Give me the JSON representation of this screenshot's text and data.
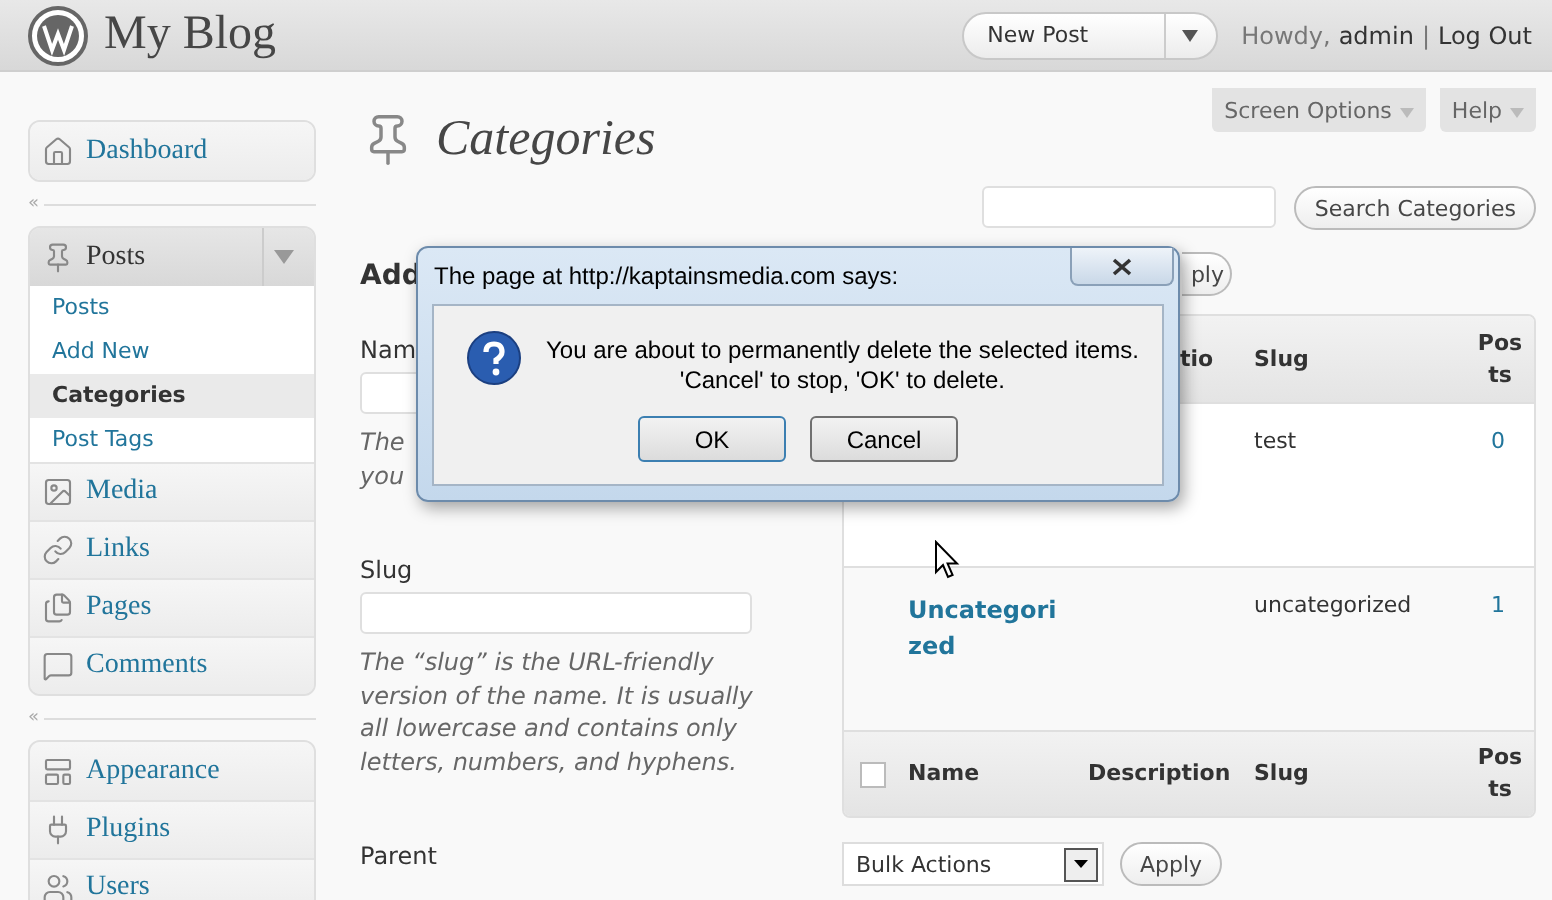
{
  "header": {
    "site_title": "My Blog",
    "new_post": "New Post",
    "greeting": "Howdy,",
    "user": "admin",
    "separator": "|",
    "logout": "Log Out"
  },
  "screen_tabs": [
    "Screen Options",
    "Help"
  ],
  "sidebar": {
    "groups": [
      {
        "items": [
          {
            "label": "Dashboard"
          }
        ]
      },
      {
        "items": [
          {
            "label": "Posts",
            "expanded": true,
            "children": [
              {
                "label": "Posts",
                "selected": false
              },
              {
                "label": "Add New",
                "selected": false
              },
              {
                "label": "Categories",
                "selected": true
              },
              {
                "label": "Post Tags",
                "selected": false
              }
            ]
          },
          {
            "label": "Media"
          },
          {
            "label": "Links"
          },
          {
            "label": "Pages"
          },
          {
            "label": "Comments"
          }
        ]
      },
      {
        "items": [
          {
            "label": "Appearance"
          },
          {
            "label": "Plugins"
          },
          {
            "label": "Users"
          }
        ]
      }
    ],
    "collapse_marks": [
      "«",
      "«"
    ]
  },
  "page_title": "Categories",
  "search": {
    "button": "Search Categories"
  },
  "form": {
    "heading": "Add",
    "fields": [
      {
        "label": "Nam",
        "description": "The you"
      },
      {
        "label": "Slug",
        "description": "The “slug” is the URL-friendly version of the name. It is usually all lowercase and contains only letters, numbers, and hyphens."
      },
      {
        "label": "Parent"
      }
    ]
  },
  "top_bulk": {
    "apply": "ply"
  },
  "table": {
    "header_top": {
      "description": "tio",
      "slug": "Slug",
      "posts": "Posts"
    },
    "rows": [
      {
        "slug": "test",
        "posts": "0"
      },
      {
        "name": "Uncategorized",
        "slug": "uncategorized",
        "posts": "1"
      }
    ],
    "footer": {
      "checked": false,
      "name": "Name",
      "description": "Description",
      "slug": "Slug",
      "posts": "Posts"
    }
  },
  "bottom_bulk": {
    "select": "Bulk Actions",
    "apply": "Apply"
  },
  "dialog": {
    "title": "The page at http://kaptainsmedia.com says:",
    "message": "You are about to permanently delete the selected items.\n'Cancel' to stop, 'OK' to delete.",
    "buttons": [
      "OK",
      "Cancel"
    ]
  }
}
